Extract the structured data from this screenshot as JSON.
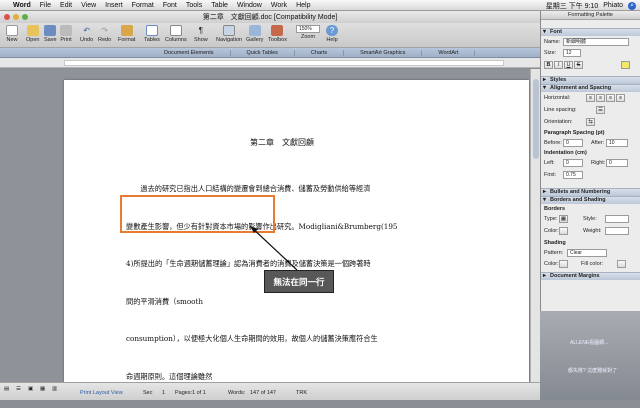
{
  "menubar": {
    "app": "Word",
    "items": [
      "File",
      "Edit",
      "View",
      "Insert",
      "Format",
      "Font",
      "Tools",
      "Table",
      "Window",
      "Work",
      "Help"
    ],
    "clock": "星期三 下午 9:10",
    "user": "Phiato"
  },
  "window": {
    "title": "第二章　文獻回顧.doc [Compatibility Mode]"
  },
  "toolbar": {
    "items": [
      "New",
      "Open",
      "Save",
      "Print",
      "Undo",
      "Redo",
      "Format",
      "Tables",
      "Columns",
      "Show",
      "Navigation",
      "Gallery",
      "Toolbox",
      "Zoom",
      "Help"
    ],
    "zoom_value": "150%"
  },
  "ribbon": {
    "tabs": [
      "Document Elements",
      "Quick Tables",
      "Charts",
      "SmartArt Graphics",
      "WordArt"
    ]
  },
  "document": {
    "title": "第二章　文獻回顧",
    "lines": [
      "　　過去的研究已指出人口結構的變遷會到總合消費、儲蓄及勞動供給等經濟",
      "變數產生影響，但少有針對資本市場的影響作出研究。Modigliani&Brumberg(195",
      "4)所提出的「生命週期儲蓄理論」認為消費者的消費及儲蓄決策是一個跨著時",
      "間的平滑消費（smooth",
      "consumption），以便極大化個人生命期間的效用，故個人的儲蓄決策應符合生",
      "命週期原則。這個理論雖然"
    ]
  },
  "callout": {
    "text": "無法在同一行"
  },
  "statusbar": {
    "view": "Print Layout View",
    "sec_label": "Sec",
    "sec_value": "1",
    "pages_label": "Pages:",
    "pages_value": "1 of 1",
    "words_label": "Words:",
    "words_value": "147 of 147",
    "trk": "TRK"
  },
  "palette": {
    "title": "Formatting Palette",
    "sections": {
      "font": "Font",
      "styles": "Styles",
      "alignment": "Alignment and Spacing",
      "bullets": "Bullets and Numbering",
      "borders": "Borders and Shading",
      "margins": "Document Margins"
    },
    "font_name_label": "Name:",
    "font_name_value": "新細明體",
    "size_label": "Size:",
    "size_value": "12",
    "horizontal_label": "Horizontal:",
    "line_spacing_label": "Line spacing:",
    "orientation_label": "Orientation:",
    "para_spacing_label": "Paragraph Spacing (pt)",
    "before_label": "Before:",
    "before_value": "0",
    "after_label": "After:",
    "after_value": "10",
    "indentation_label": "Indentation (cm)",
    "left_label": "Left:",
    "left_value": "0",
    "right_label": "Right:",
    "right_value": "0",
    "first_label": "First:",
    "first_value": "0.75",
    "borders_label": "Borders",
    "type_label": "Type:",
    "style_label": "Style:",
    "color_label": "Color:",
    "weight_label": "Weight:",
    "shading_label": "Shading",
    "pattern_label": "Pattern:",
    "pattern_value": "Clear",
    "color2_label": "Color:",
    "fill_label": "Fill color:"
  },
  "desktop": {
    "text1": "ALLENE看圖網...",
    "text2": "都失敗? 這麼難就對了"
  },
  "colors": {
    "highlight_border": "#e87a32",
    "callout_bg": "#585858",
    "ribbon": "#a9b9cf"
  }
}
